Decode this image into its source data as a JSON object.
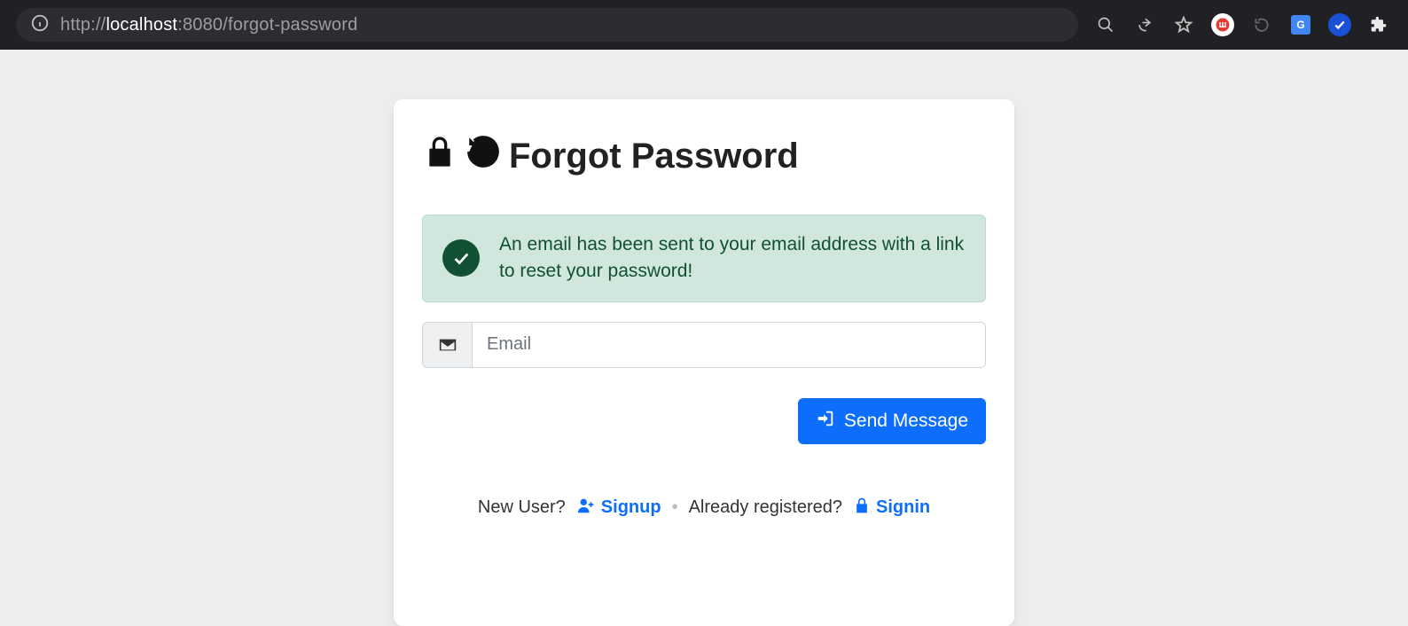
{
  "browser": {
    "url_scheme": "http://",
    "url_host": "localhost",
    "url_port_path": ":8080/forgot-password"
  },
  "card": {
    "title": "Forgot Password",
    "alert_message": "An email has been sent to your email address with a link to reset your password!",
    "email_placeholder": "Email",
    "email_value": "",
    "send_button_label": "Send Message",
    "footer": {
      "new_user_text": "New User?",
      "signup_label": "Signup",
      "already_text": "Already registered?",
      "signin_label": "Signin"
    }
  }
}
